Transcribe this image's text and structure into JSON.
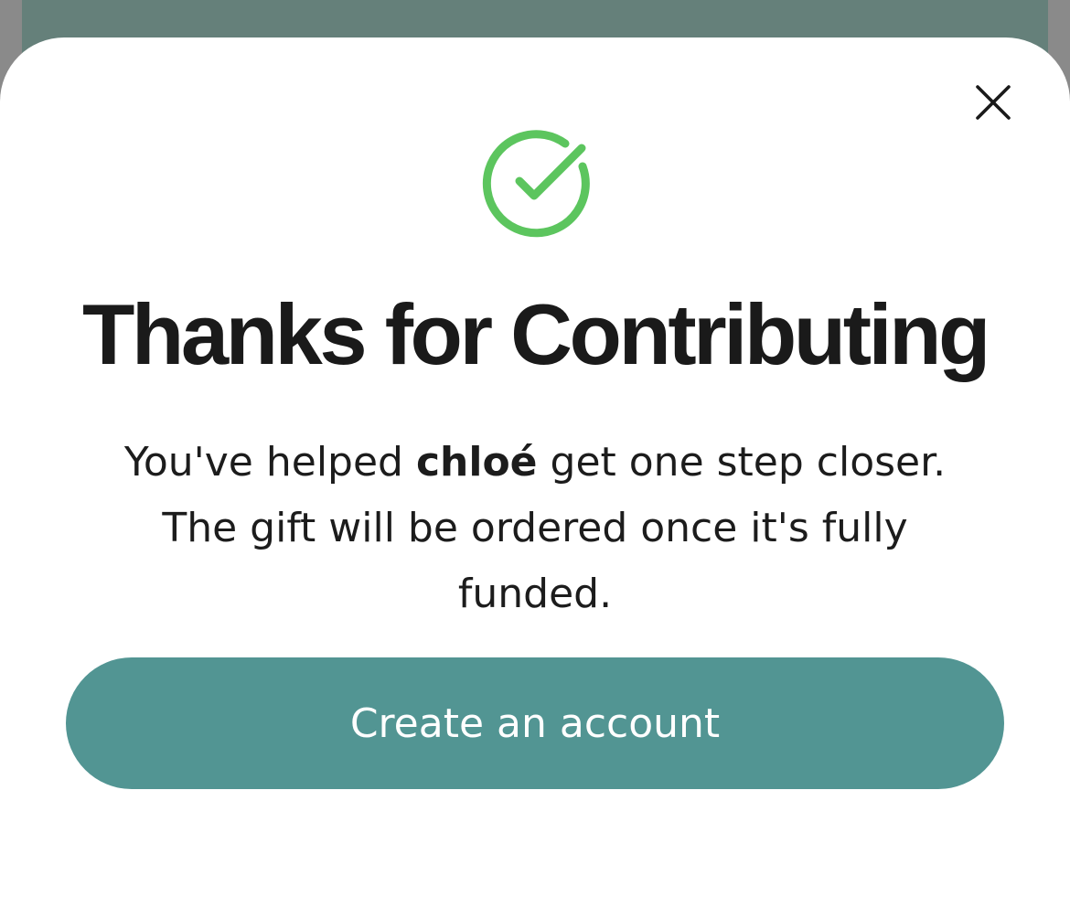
{
  "modal": {
    "title": "Thanks for Contributing",
    "message": {
      "prefix": "You've helped ",
      "recipient": "chloé",
      "suffix": " get one step closer. The gift will be ordered once it's fully funded."
    },
    "primary_button": "Create an account",
    "close_icon": "close-icon",
    "success_icon": "check-circle-icon"
  },
  "colors": {
    "accent": "#529593",
    "success": "#5cc55e",
    "title_text": "#1a1a1a",
    "underlay": "#65807a"
  }
}
